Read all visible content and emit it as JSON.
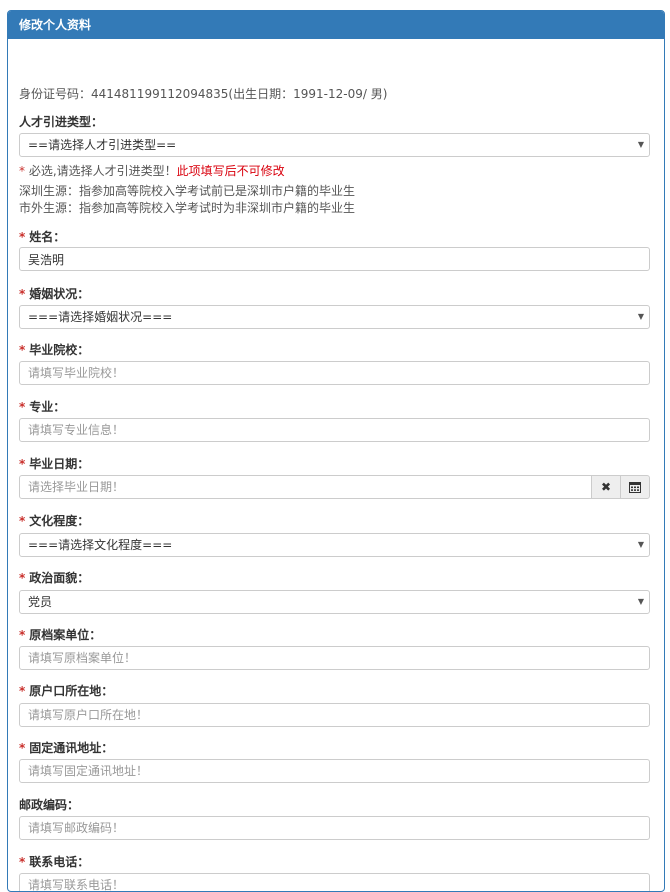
{
  "panel": {
    "title": "修改个人资料"
  },
  "id_info": "身份证号码：441481199112094835(出生日期：1991-12-09/ 男)",
  "talent_type": {
    "label": "人才引进类型：",
    "selected": "==请选择人才引进类型==",
    "hint_prefix": "必选,请选择人才引进类型！",
    "hint_emphasis": "此项填写后不可修改",
    "notes": [
      "深圳生源：指参加高等院校入学考试前已是深圳市户籍的毕业生",
      "市外生源：指参加高等院校入学考试时为非深圳市户籍的毕业生"
    ]
  },
  "required_mark": "*",
  "name": {
    "label": "姓名：",
    "value": "吴浩明"
  },
  "marital": {
    "label": "婚姻状况：",
    "selected": "===请选择婚姻状况==="
  },
  "school": {
    "label": "毕业院校：",
    "placeholder": "请填写毕业院校！"
  },
  "major": {
    "label": "专业：",
    "placeholder": "请填写专业信息！"
  },
  "grad_date": {
    "label": "毕业日期：",
    "placeholder": "请选择毕业日期！",
    "clear_glyph": "✖"
  },
  "education": {
    "label": "文化程度：",
    "selected": "===请选择文化程度==="
  },
  "political": {
    "label": "政治面貌：",
    "selected": "党员"
  },
  "archive_unit": {
    "label": "原档案单位：",
    "placeholder": "请填写原档案单位！"
  },
  "hukou": {
    "label": "原户口所在地：",
    "placeholder": "请填写原户口所在地！"
  },
  "address": {
    "label": "固定通讯地址：",
    "placeholder": "请填写固定通讯地址！"
  },
  "postcode": {
    "label": "邮政编码：",
    "placeholder": "请填写邮政编码！"
  },
  "phone": {
    "label": "联系电话：",
    "placeholder": "请填写联系电话！"
  },
  "caret_glyph": "▼",
  "colors": {
    "header": "#337ab7",
    "required": "#c9302c",
    "border": "#cccccc"
  }
}
